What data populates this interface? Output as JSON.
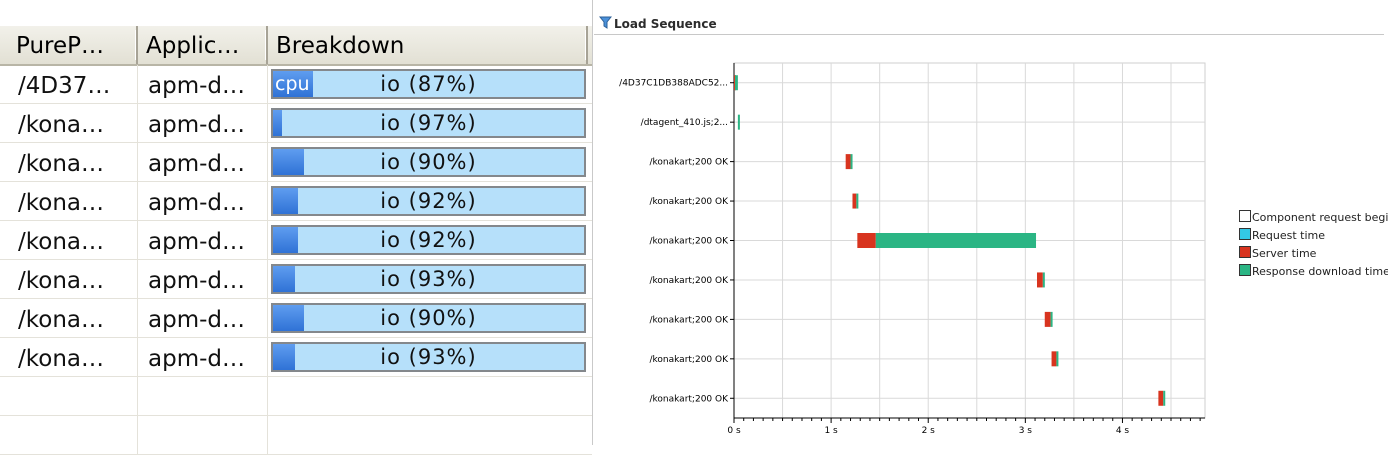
{
  "grid": {
    "columns": [
      "PureP…",
      "Applic…",
      "Breakdown"
    ],
    "rows": [
      {
        "path": "/4D37…",
        "app": "apm-d…",
        "cpu_fraction": 0.13,
        "cpu_label": "cpu",
        "breakdown": "io  (87%)"
      },
      {
        "path": "/kona…",
        "app": "apm-d…",
        "cpu_fraction": 0.03,
        "cpu_label": "",
        "breakdown": "io  (97%)"
      },
      {
        "path": "/kona…",
        "app": "apm-d…",
        "cpu_fraction": 0.1,
        "cpu_label": "",
        "breakdown": "io  (90%)"
      },
      {
        "path": "/kona…",
        "app": "apm-d…",
        "cpu_fraction": 0.08,
        "cpu_label": "",
        "breakdown": "io  (92%)"
      },
      {
        "path": "/kona…",
        "app": "apm-d…",
        "cpu_fraction": 0.08,
        "cpu_label": "",
        "breakdown": "io  (92%)"
      },
      {
        "path": "/kona…",
        "app": "apm-d…",
        "cpu_fraction": 0.07,
        "cpu_label": "",
        "breakdown": "io  (93%)"
      },
      {
        "path": "/kona…",
        "app": "apm-d…",
        "cpu_fraction": 0.1,
        "cpu_label": "",
        "breakdown": "io  (90%)"
      },
      {
        "path": "/kona…",
        "app": "apm-d…",
        "cpu_fraction": 0.07,
        "cpu_label": "",
        "breakdown": "io  (93%)"
      }
    ],
    "empty_rows": 2
  },
  "panel": {
    "title": "Load Sequence",
    "icon": "filter-icon"
  },
  "chart_data": {
    "type": "bar",
    "orientation": "horizontal-stacked-gantt",
    "title": "",
    "xlabel": "",
    "ylabel": "",
    "xlim": [
      0,
      4.85
    ],
    "x_ticks": [
      0,
      1,
      2,
      3,
      4
    ],
    "x_tick_labels": [
      "0 s",
      "1 s",
      "2 s",
      "3 s",
      "4 s"
    ],
    "grid": true,
    "legend_position": "right",
    "categories": [
      "/4D37C1DB388ADC52...",
      "/dtagent_410.js;2...",
      "/konakart;200 OK",
      "/konakart;200 OK",
      "/konakart;200 OK",
      "/konakart;200 OK",
      "/konakart;200 OK",
      "/konakart;200 OK",
      "/konakart;200 OK"
    ],
    "series": [
      {
        "name": "Component request begin",
        "color": "#ffffff",
        "values": [
          0,
          0.04,
          1.15,
          1.22,
          1.27,
          3.12,
          3.2,
          3.27,
          4.37
        ]
      },
      {
        "name": "Request time",
        "color": "#33c8e6",
        "values": [
          0,
          0,
          0,
          0,
          0,
          0,
          0,
          0,
          0
        ]
      },
      {
        "name": "Server time",
        "color": "#d8341f",
        "values": [
          0.01,
          0,
          0.05,
          0.04,
          0.19,
          0.06,
          0.06,
          0.05,
          0.05
        ]
      },
      {
        "name": "Response download time",
        "color": "#2bb584",
        "values": [
          0.03,
          0.02,
          0.02,
          0.02,
          1.65,
          0.02,
          0.02,
          0.02,
          0.02
        ]
      }
    ]
  },
  "colors": {
    "cpu_bar": "#3a7fe0",
    "io_bar": "#b6e0fa",
    "header_bg": "#e8e6dc"
  }
}
